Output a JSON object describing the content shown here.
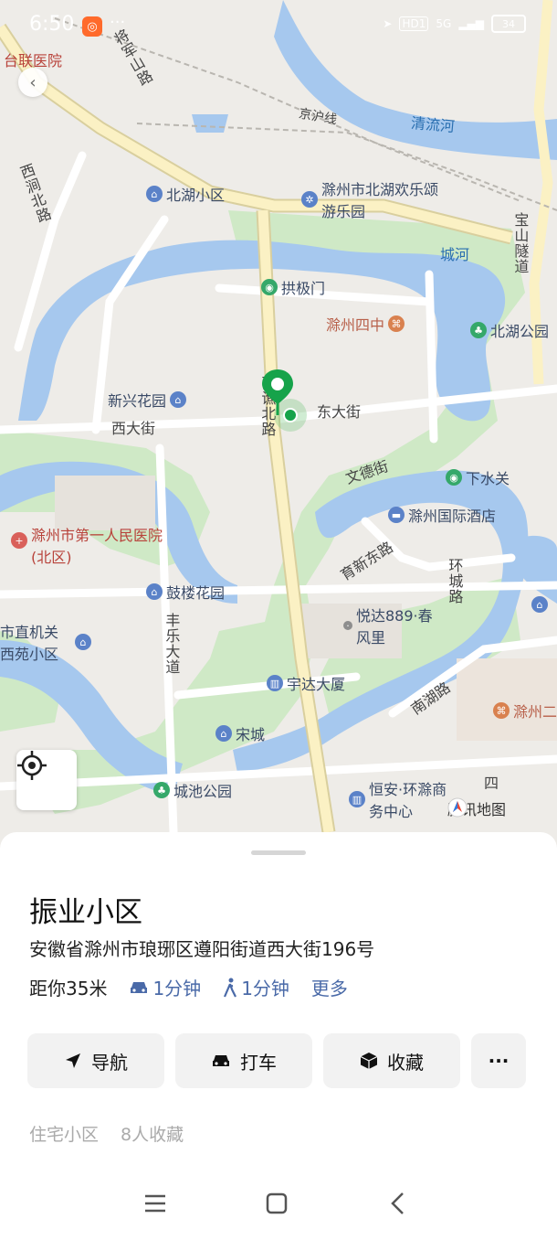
{
  "status_bar": {
    "time": "6:50",
    "app_badge": "",
    "more": "···",
    "network": "HD1",
    "signal": "5G",
    "battery": "34"
  },
  "map": {
    "labels": {
      "hospital_top": "台联医院",
      "jiangjunshan_road": "将军山路",
      "xiaoxi_road": "西涧北路",
      "jinghu_line": "京沪线",
      "qingliu_river": "清流河",
      "chenghe": "城河",
      "baoshan_tunnel": "宝山隧道",
      "xida_street": "西大街",
      "dongda_street": "东大街",
      "nanqiao_north_road": "南谯北路",
      "wende_street": "文德街",
      "yuxin_east_road": "育新东路",
      "huancheng_road": "环城路",
      "fengle_avenue": "丰乐大道",
      "nanhu_road": "南湖路",
      "sihao_road": "四"
    },
    "pois": {
      "beihu_community": "北湖小区",
      "beihu_park_amusement": "滁州市北湖欢乐颂游乐园",
      "gongji_gate": "拱极门",
      "chuzhou_no4_school": "滁州四中",
      "beihu_park": "北湖公园",
      "xinxing_garden": "新兴花园",
      "xiashuiguan": "下水关",
      "intl_hotel": "滁州国际酒店",
      "first_hospital": "滁州市第一人民医院(北区)",
      "gulou_garden": "鼓楼花园",
      "yueda889": "悦达889·春风里",
      "shizhi_jiguan": "市直机关西苑小区",
      "yuda_building": "宇达大厦",
      "songcheng": "宋城",
      "chengchi_park": "城池公园",
      "hengan_center": "恒安·环滁商务中心",
      "chuzhou_second": "滁州二"
    },
    "watermark": "腾讯地图"
  },
  "panel": {
    "name": "振业小区",
    "address": "安徽省滁州市琅琊区遵阳街道西大街196号",
    "distance": "距你35米",
    "drive_time": "1分钟",
    "walk_time": "1分钟",
    "more": "更多",
    "actions": {
      "navigate": "导航",
      "taxi": "打车",
      "favorite": "收藏",
      "overflow": "···"
    },
    "tags": [
      "住宅小区",
      "8人收藏"
    ]
  },
  "colors": {
    "water": "#a6c8ee",
    "park": "#c8e8c0",
    "road_main": "#fbf1c4",
    "pin": "#16a34a",
    "accent_link": "#4a6aa8"
  }
}
